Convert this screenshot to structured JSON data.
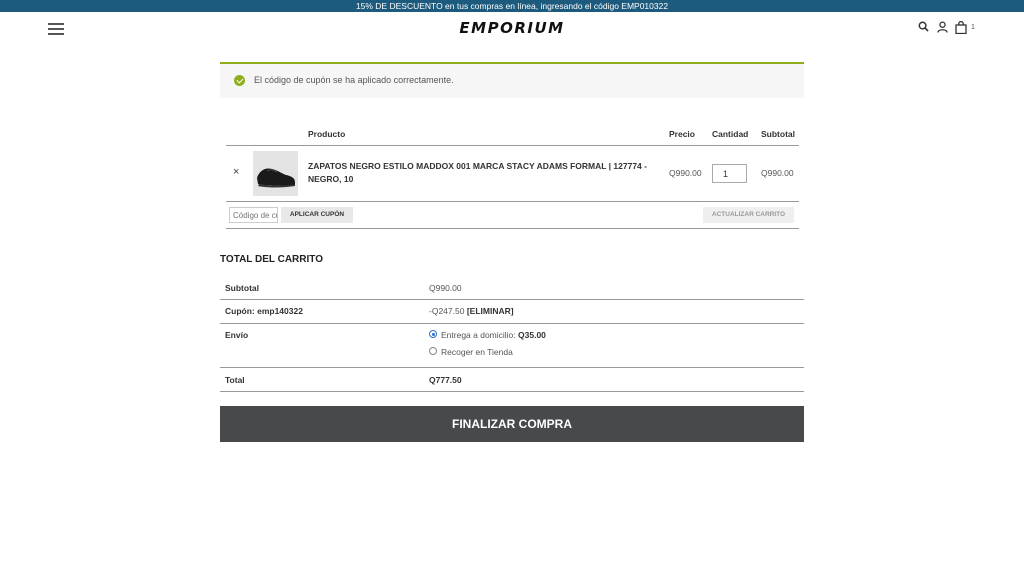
{
  "promo": {
    "text": "15% DE DESCUENTO en tus compras en línea, ingresando el código EMP010322"
  },
  "header": {
    "logo": "EMPORIUM",
    "cart_count": "1",
    "icons": [
      "menu-icon",
      "search-icon",
      "user-icon",
      "shopping-bag-icon"
    ]
  },
  "notice": {
    "text": "El código de cupón se ha aplicado correctamente."
  },
  "cart_table": {
    "columns": {
      "product": "Producto",
      "price": "Precio",
      "quantity": "Cantidad",
      "subtotal": "Subtotal"
    },
    "items": [
      {
        "remove": "×",
        "name": "ZAPATOS NEGRO ESTILO MADDOX 001 MARCA STACY ADAMS FORMAL | 127774 - NEGRO, 10",
        "price": "Q990.00",
        "quantity": "1",
        "subtotal": "Q990.00"
      }
    ],
    "coupon_placeholder": "Código de cupón",
    "apply_coupon": "APLICAR CUPÓN",
    "update_cart": "ACTUALIZAR CARRITO"
  },
  "totals": {
    "title": "TOTAL DEL CARRITO",
    "subtotal_label": "Subtotal",
    "subtotal_value": "Q990.00",
    "coupon_label": "Cupón: emp140322",
    "coupon_value": "-Q247.50",
    "coupon_remove": "[ELIMINAR]",
    "shipping_label": "Envío",
    "shipping_options": [
      {
        "label": "Entrega a domicilio: ",
        "price": "Q35.00",
        "selected": true
      },
      {
        "label": "Recoger en Tienda",
        "price": "",
        "selected": false
      }
    ],
    "total_label": "Total",
    "total_value": "Q777.50"
  },
  "checkout_button": "FINALIZAR COMPRA",
  "colors": {
    "promo_bar": "#1d5b7e",
    "notice_accent": "#8fae1b",
    "checkout_button": "#47494d"
  }
}
